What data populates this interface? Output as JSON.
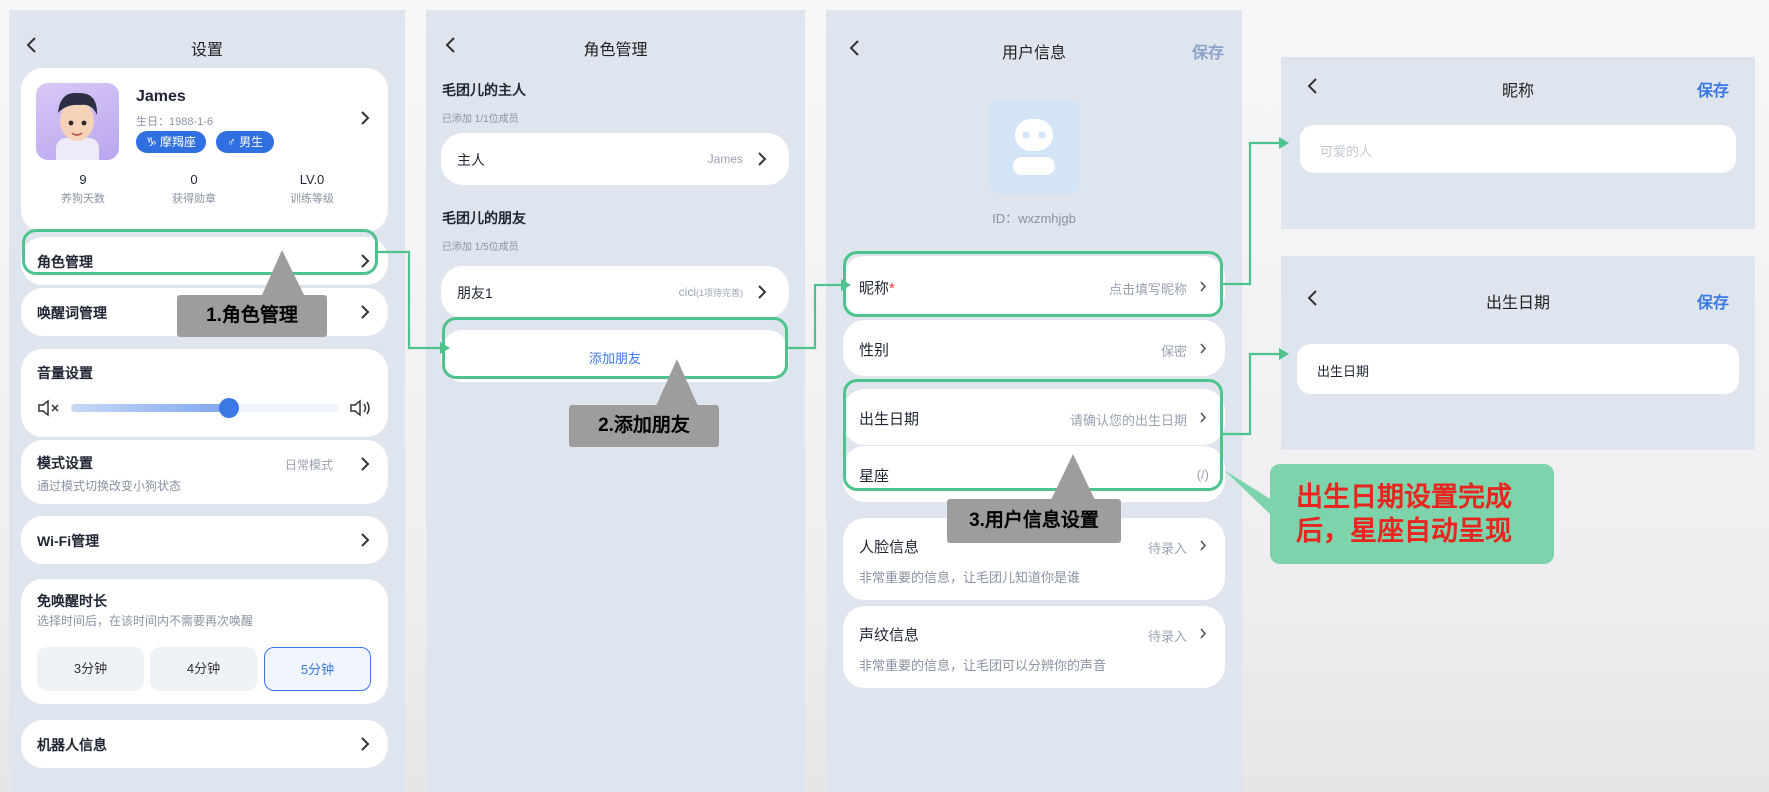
{
  "screen1": {
    "title": "设置",
    "profile": {
      "name": "James",
      "birthday": "生日：1988-1-6",
      "tag_zodiac": "♑ 摩羯座",
      "tag_gender": "♂ 男生"
    },
    "stats": [
      {
        "value": "9",
        "label": "养狗天数"
      },
      {
        "value": "0",
        "label": "获得勋章"
      },
      {
        "value": "LV.0",
        "label": "训练等级"
      }
    ],
    "role_mgmt": "角色管理",
    "wake_word": "唤醒词管理",
    "volume": {
      "title": "音量设置",
      "level_percent": 55
    },
    "mode": {
      "title": "模式设置",
      "desc": "通过模式切换改变小狗状态",
      "value": "日常模式"
    },
    "wifi": "Wi-Fi管理",
    "no_wake": {
      "title": "免唤醒时长",
      "desc": "选择时间后，在该时间内不需要再次唤醒",
      "options": [
        "3分钟",
        "4分钟",
        "5分钟"
      ],
      "selected": "5分钟"
    },
    "robot_info": "机器人信息"
  },
  "screen2": {
    "title": "角色管理",
    "owner_section": "毛团儿的主人",
    "owner_count": "已添加 1/1位成员",
    "owner_label": "主人",
    "owner_value": "James",
    "friend_section": "毛团儿的朋友",
    "friend_count": "已添加 1/5位成员",
    "friend_label": "朋友1",
    "friend_value": "cici",
    "friend_note": "(1项待完善)",
    "add_friend": "添加朋友"
  },
  "screen3": {
    "title": "用户信息",
    "save": "保存",
    "user_id": "ID：wxzmhjgb",
    "nickname_label": "昵称",
    "required_mark": "*",
    "nickname_value": "点击填写昵称",
    "gender_label": "性别",
    "gender_value": "保密",
    "birth_label": "出生日期",
    "birth_value": "请确认您的出生日期",
    "zodiac_label": "星座",
    "zodiac_value": "(/)",
    "face_label": "人脸信息",
    "face_value": "待录入",
    "face_desc": "非常重要的信息，让毛团儿知道你是谁",
    "voice_label": "声纹信息",
    "voice_value": "待录入",
    "voice_desc": "非常重要的信息，让毛团可以分辨你的声音"
  },
  "screen4": {
    "title": "昵称",
    "save": "保存",
    "placeholder": "可爱的人"
  },
  "screen5": {
    "title": "出生日期",
    "save": "保存",
    "field": "出生日期"
  },
  "annotations": {
    "callout1": "1.角色管理",
    "callout2": "2.添加朋友",
    "callout3": "3.用户信息设置",
    "note": "出生日期设置完成后，星座自动呈现"
  },
  "colors": {
    "accent": "#3a78e6",
    "highlight": "#4fc38e",
    "note_bg": "#7dd3ab",
    "note_text": "#e8261f",
    "callout_bg": "#9d9d9d"
  }
}
